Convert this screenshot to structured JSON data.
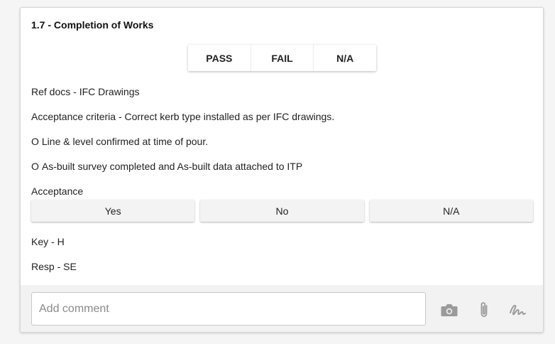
{
  "section": {
    "title": "1.7 - Completion of Works",
    "result_options": [
      "PASS",
      "FAIL",
      "N/A"
    ]
  },
  "details": {
    "ref_docs": "Ref docs - IFC Drawings",
    "acceptance_criteria": "Acceptance criteria - Correct kerb type installed as per IFC drawings.",
    "check_items": [
      "Line & level confirmed at time of pour.",
      "As-built survey completed and As-built data attached to ITP"
    ],
    "bullet_glyph": "O"
  },
  "acceptance": {
    "label": "Acceptance",
    "options": [
      "Yes",
      "No",
      "N/A"
    ]
  },
  "meta": {
    "key": "Key - H",
    "resp": "Resp - SE"
  },
  "comment": {
    "placeholder": "Add comment",
    "value": ""
  },
  "icons": {
    "camera": "camera-icon",
    "attach": "paperclip-icon",
    "sign": "signature-icon",
    "color": "#9a9a9a"
  }
}
